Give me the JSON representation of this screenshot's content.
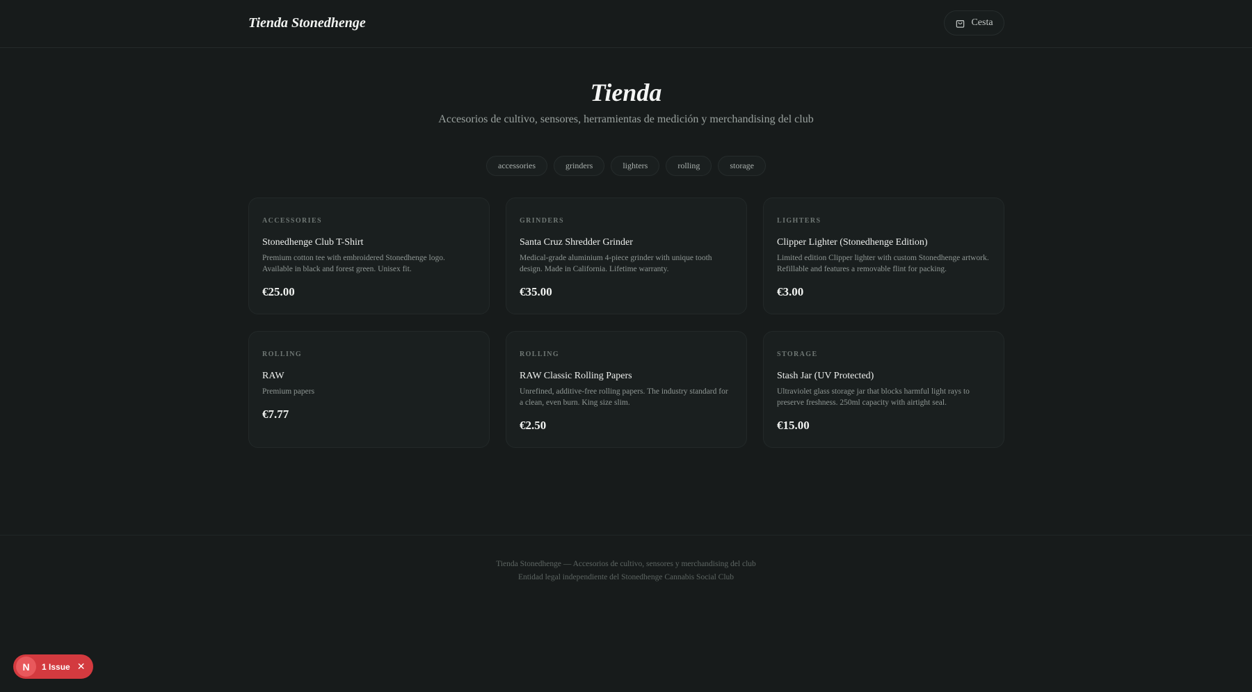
{
  "header": {
    "brand": "Tienda Stonedhenge",
    "cart_label": "Cesta"
  },
  "hero": {
    "title": "Tienda",
    "subtitle": "Accesorios de cultivo, sensores, herramientas de medición y merchandising del club"
  },
  "filters": [
    "accessories",
    "grinders",
    "lighters",
    "rolling",
    "storage"
  ],
  "products": [
    {
      "category": "ACCESSORIES",
      "name": "Stonedhenge Club T-Shirt",
      "description": "Premium cotton tee with embroidered Stonedhenge logo. Available in black and forest green. Unisex fit.",
      "price": "€25.00"
    },
    {
      "category": "GRINDERS",
      "name": "Santa Cruz Shredder Grinder",
      "description": "Medical-grade aluminium 4-piece grinder with unique tooth design. Made in California. Lifetime warranty.",
      "price": "€35.00"
    },
    {
      "category": "LIGHTERS",
      "name": "Clipper Lighter (Stonedhenge Edition)",
      "description": "Limited edition Clipper lighter with custom Stonedhenge artwork. Refillable and features a removable flint for packing.",
      "price": "€3.00"
    },
    {
      "category": "ROLLING",
      "name": "RAW",
      "description": "Premium papers",
      "price": "€7.77"
    },
    {
      "category": "ROLLING",
      "name": "RAW Classic Rolling Papers",
      "description": "Unrefined, additive-free rolling papers. The industry standard for a clean, even burn. King size slim.",
      "price": "€2.50"
    },
    {
      "category": "STORAGE",
      "name": "Stash Jar (UV Protected)",
      "description": "Ultraviolet glass storage jar that blocks harmful light rays to preserve freshness. 250ml capacity with airtight seal.",
      "price": "€15.00"
    }
  ],
  "footer": {
    "line1": "Tienda Stonedhenge — Accesorios de cultivo, sensores y merchandising del club",
    "line2": "Entidad legal independiente del Stonedhenge Cannabis Social Club"
  },
  "dev_overlay": {
    "badge_letter": "N",
    "issue_label": "1 Issue",
    "close_glyph": "✕"
  },
  "icons": {
    "cart": "shopping-bag-icon"
  }
}
